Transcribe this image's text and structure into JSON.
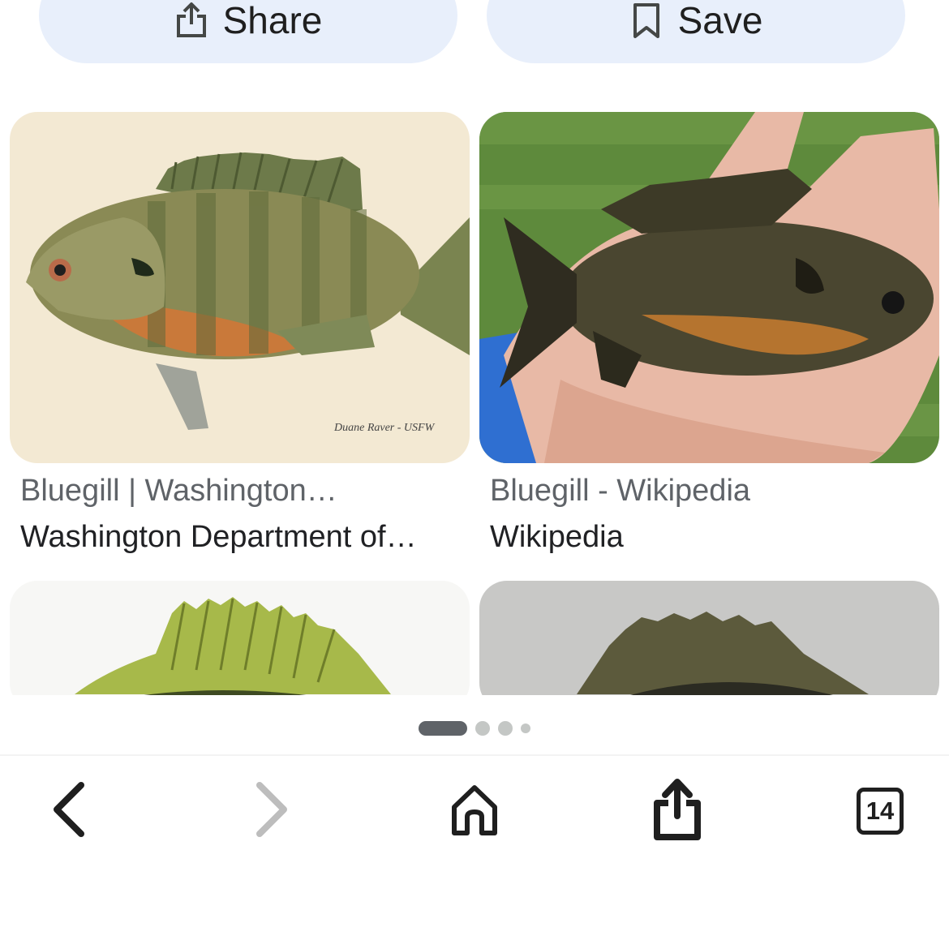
{
  "actions": {
    "share_label": "Share",
    "save_label": "Save"
  },
  "results": [
    {
      "title": "Bluegill | Washington…",
      "source": "Washington Department of…"
    },
    {
      "title": "Bluegill - Wikipedia",
      "source": "Wikipedia"
    }
  ],
  "watermark": "Duane Raver - USFW",
  "pager": {
    "pages": 4,
    "active": 1
  },
  "toolbar": {
    "tab_count": "14",
    "icons": [
      "back-arrow-icon",
      "forward-arrow-icon",
      "home-icon",
      "share-icon",
      "tabs-icon"
    ]
  },
  "colors": {
    "pill_bg": "#e8effb",
    "text_primary": "#202124",
    "text_secondary": "#5f6368"
  }
}
